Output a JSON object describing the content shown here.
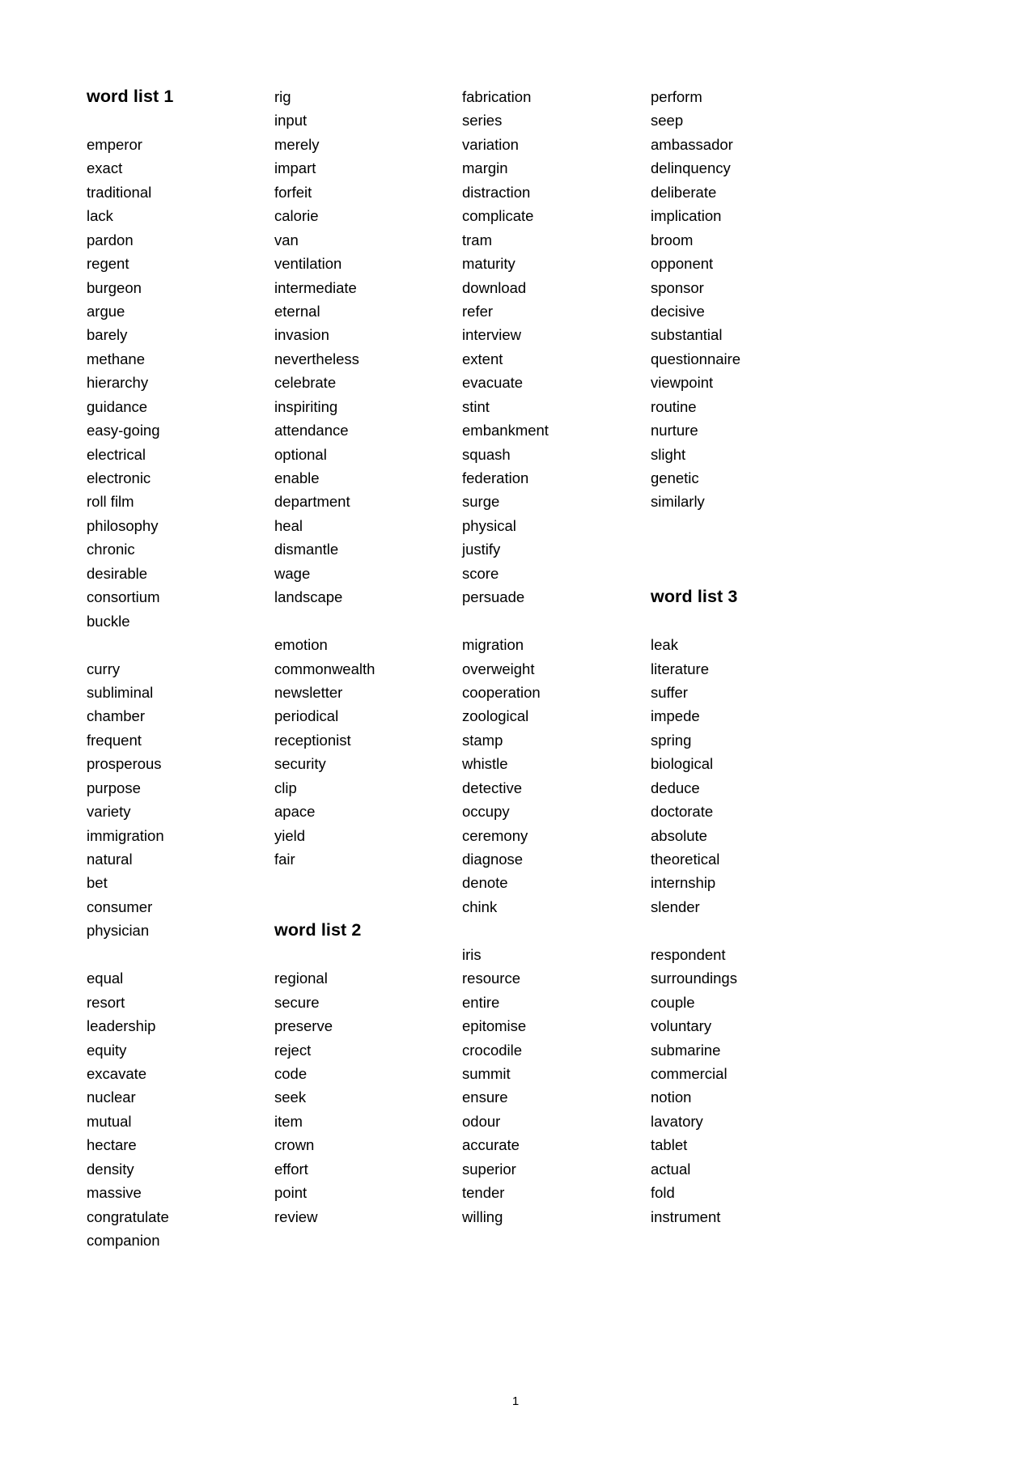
{
  "document": {
    "page_number": "1",
    "columns": [
      {
        "id": "column-1",
        "lines": [
          {
            "type": "heading",
            "text": "word list 1"
          },
          {
            "type": "blank"
          },
          {
            "type": "word",
            "text": "emperor"
          },
          {
            "type": "word",
            "text": "exact"
          },
          {
            "type": "word",
            "text": "traditional"
          },
          {
            "type": "word",
            "text": "lack"
          },
          {
            "type": "word",
            "text": "pardon"
          },
          {
            "type": "word",
            "text": "regent"
          },
          {
            "type": "word",
            "text": "burgeon"
          },
          {
            "type": "word",
            "text": "argue"
          },
          {
            "type": "word",
            "text": "barely"
          },
          {
            "type": "word",
            "text": "methane"
          },
          {
            "type": "word",
            "text": "hierarchy"
          },
          {
            "type": "word",
            "text": "guidance"
          },
          {
            "type": "word",
            "text": "easy-going"
          },
          {
            "type": "word",
            "text": "electrical"
          },
          {
            "type": "word",
            "text": "electronic"
          },
          {
            "type": "word",
            "text": "roll film"
          },
          {
            "type": "word",
            "text": "philosophy"
          },
          {
            "type": "word",
            "text": "chronic"
          },
          {
            "type": "word",
            "text": "desirable"
          },
          {
            "type": "word",
            "text": "consortium"
          },
          {
            "type": "word",
            "text": "buckle"
          },
          {
            "type": "blank"
          },
          {
            "type": "word",
            "text": "curry"
          },
          {
            "type": "word",
            "text": "subliminal"
          },
          {
            "type": "word",
            "text": "chamber"
          },
          {
            "type": "word",
            "text": "frequent"
          },
          {
            "type": "word",
            "text": "prosperous"
          },
          {
            "type": "word",
            "text": "purpose"
          },
          {
            "type": "word",
            "text": "variety"
          },
          {
            "type": "word",
            "text": "immigration"
          },
          {
            "type": "word",
            "text": "natural"
          },
          {
            "type": "word",
            "text": "bet"
          },
          {
            "type": "word",
            "text": "consumer"
          },
          {
            "type": "word",
            "text": "physician"
          },
          {
            "type": "blank"
          },
          {
            "type": "word",
            "text": "equal"
          },
          {
            "type": "word",
            "text": "resort"
          },
          {
            "type": "word",
            "text": "leadership"
          },
          {
            "type": "word",
            "text": "equity"
          },
          {
            "type": "word",
            "text": "excavate"
          },
          {
            "type": "word",
            "text": "nuclear"
          },
          {
            "type": "word",
            "text": "mutual"
          },
          {
            "type": "word",
            "text": "hectare"
          },
          {
            "type": "word",
            "text": "density"
          },
          {
            "type": "word",
            "text": "massive"
          },
          {
            "type": "word",
            "text": "congratulate"
          },
          {
            "type": "word",
            "text": "companion"
          }
        ]
      },
      {
        "id": "column-2",
        "lines": [
          {
            "type": "word",
            "text": "rig"
          },
          {
            "type": "word",
            "text": "input"
          },
          {
            "type": "word",
            "text": "merely"
          },
          {
            "type": "word",
            "text": "impart"
          },
          {
            "type": "word",
            "text": "forfeit"
          },
          {
            "type": "word",
            "text": "calorie"
          },
          {
            "type": "word",
            "text": "van"
          },
          {
            "type": "word",
            "text": "ventilation"
          },
          {
            "type": "word",
            "text": "intermediate"
          },
          {
            "type": "word",
            "text": "eternal"
          },
          {
            "type": "word",
            "text": "invasion"
          },
          {
            "type": "word",
            "text": "nevertheless"
          },
          {
            "type": "word",
            "text": "celebrate"
          },
          {
            "type": "word",
            "text": "inspiriting"
          },
          {
            "type": "word",
            "text": "attendance"
          },
          {
            "type": "word",
            "text": "optional"
          },
          {
            "type": "word",
            "text": "enable"
          },
          {
            "type": "word",
            "text": "department"
          },
          {
            "type": "word",
            "text": "heal"
          },
          {
            "type": "word",
            "text": "dismantle"
          },
          {
            "type": "word",
            "text": "wage"
          },
          {
            "type": "word",
            "text": "landscape"
          },
          {
            "type": "blank"
          },
          {
            "type": "word",
            "text": "emotion"
          },
          {
            "type": "word",
            "text": "commonwealth"
          },
          {
            "type": "word",
            "text": "newsletter"
          },
          {
            "type": "word",
            "text": "periodical"
          },
          {
            "type": "word",
            "text": "receptionist"
          },
          {
            "type": "word",
            "text": "security"
          },
          {
            "type": "word",
            "text": "clip"
          },
          {
            "type": "word",
            "text": "apace"
          },
          {
            "type": "word",
            "text": "yield"
          },
          {
            "type": "word",
            "text": "fair"
          },
          {
            "type": "blank"
          },
          {
            "type": "blank"
          },
          {
            "type": "heading",
            "text": "word list 2"
          },
          {
            "type": "blank"
          },
          {
            "type": "word",
            "text": "regional"
          },
          {
            "type": "word",
            "text": "secure"
          },
          {
            "type": "word",
            "text": "preserve"
          },
          {
            "type": "word",
            "text": "reject"
          },
          {
            "type": "word",
            "text": "code"
          },
          {
            "type": "word",
            "text": "seek"
          },
          {
            "type": "word",
            "text": "item"
          },
          {
            "type": "word",
            "text": "crown"
          },
          {
            "type": "word",
            "text": "effort"
          },
          {
            "type": "word",
            "text": "point"
          },
          {
            "type": "word",
            "text": "review"
          }
        ]
      },
      {
        "id": "column-3",
        "lines": [
          {
            "type": "word",
            "text": "fabrication"
          },
          {
            "type": "word",
            "text": "series"
          },
          {
            "type": "word",
            "text": "variation"
          },
          {
            "type": "word",
            "text": "margin"
          },
          {
            "type": "word",
            "text": "distraction"
          },
          {
            "type": "word",
            "text": "complicate"
          },
          {
            "type": "word",
            "text": "tram"
          },
          {
            "type": "word",
            "text": "maturity"
          },
          {
            "type": "word",
            "text": "download"
          },
          {
            "type": "word",
            "text": "refer"
          },
          {
            "type": "word",
            "text": "interview"
          },
          {
            "type": "word",
            "text": "extent"
          },
          {
            "type": "word",
            "text": "evacuate"
          },
          {
            "type": "word",
            "text": "stint"
          },
          {
            "type": "word",
            "text": "embankment"
          },
          {
            "type": "word",
            "text": "squash"
          },
          {
            "type": "word",
            "text": "federation"
          },
          {
            "type": "word",
            "text": "surge"
          },
          {
            "type": "word",
            "text": "physical"
          },
          {
            "type": "word",
            "text": "justify"
          },
          {
            "type": "word",
            "text": "score"
          },
          {
            "type": "word",
            "text": "persuade"
          },
          {
            "type": "blank"
          },
          {
            "type": "word",
            "text": "migration"
          },
          {
            "type": "word",
            "text": "overweight"
          },
          {
            "type": "word",
            "text": "cooperation"
          },
          {
            "type": "word",
            "text": "zoological"
          },
          {
            "type": "word",
            "text": "stamp"
          },
          {
            "type": "word",
            "text": "whistle"
          },
          {
            "type": "word",
            "text": "detective"
          },
          {
            "type": "word",
            "text": "occupy"
          },
          {
            "type": "word",
            "text": "ceremony"
          },
          {
            "type": "word",
            "text": "diagnose"
          },
          {
            "type": "word",
            "text": "denote"
          },
          {
            "type": "word",
            "text": "chink"
          },
          {
            "type": "blank"
          },
          {
            "type": "word",
            "text": "iris"
          },
          {
            "type": "word",
            "text": "resource"
          },
          {
            "type": "word",
            "text": "entire"
          },
          {
            "type": "word",
            "text": "epitomise"
          },
          {
            "type": "word",
            "text": "crocodile"
          },
          {
            "type": "word",
            "text": "summit"
          },
          {
            "type": "word",
            "text": "ensure"
          },
          {
            "type": "word",
            "text": "odour"
          },
          {
            "type": "word",
            "text": "accurate"
          },
          {
            "type": "word",
            "text": "superior"
          },
          {
            "type": "word",
            "text": "tender"
          },
          {
            "type": "word",
            "text": "willing"
          }
        ]
      },
      {
        "id": "column-4",
        "lines": [
          {
            "type": "word",
            "text": "perform"
          },
          {
            "type": "word",
            "text": "seep"
          },
          {
            "type": "word",
            "text": "ambassador"
          },
          {
            "type": "word",
            "text": "delinquency"
          },
          {
            "type": "word",
            "text": "deliberate"
          },
          {
            "type": "word",
            "text": "implication"
          },
          {
            "type": "word",
            "text": "broom"
          },
          {
            "type": "word",
            "text": "opponent"
          },
          {
            "type": "word",
            "text": "sponsor"
          },
          {
            "type": "word",
            "text": "decisive"
          },
          {
            "type": "word",
            "text": "substantial"
          },
          {
            "type": "word",
            "text": "questionnaire"
          },
          {
            "type": "word",
            "text": "viewpoint"
          },
          {
            "type": "word",
            "text": "routine"
          },
          {
            "type": "word",
            "text": "nurture"
          },
          {
            "type": "word",
            "text": "slight"
          },
          {
            "type": "word",
            "text": "genetic"
          },
          {
            "type": "word",
            "text": "similarly"
          },
          {
            "type": "blank"
          },
          {
            "type": "blank"
          },
          {
            "type": "blank"
          },
          {
            "type": "heading",
            "text": "word list 3"
          },
          {
            "type": "blank"
          },
          {
            "type": "word",
            "text": "leak"
          },
          {
            "type": "word",
            "text": "literature"
          },
          {
            "type": "word",
            "text": "suffer"
          },
          {
            "type": "word",
            "text": "impede"
          },
          {
            "type": "word",
            "text": "spring"
          },
          {
            "type": "word",
            "text": "biological"
          },
          {
            "type": "word",
            "text": "deduce"
          },
          {
            "type": "word",
            "text": "doctorate"
          },
          {
            "type": "word",
            "text": "absolute"
          },
          {
            "type": "word",
            "text": "theoretical"
          },
          {
            "type": "word",
            "text": "internship"
          },
          {
            "type": "word",
            "text": "slender"
          },
          {
            "type": "blank"
          },
          {
            "type": "word",
            "text": "respondent"
          },
          {
            "type": "word",
            "text": "surroundings"
          },
          {
            "type": "word",
            "text": "couple"
          },
          {
            "type": "word",
            "text": "voluntary"
          },
          {
            "type": "word",
            "text": "submarine"
          },
          {
            "type": "word",
            "text": "commercial"
          },
          {
            "type": "word",
            "text": "notion"
          },
          {
            "type": "word",
            "text": "lavatory"
          },
          {
            "type": "word",
            "text": "tablet"
          },
          {
            "type": "word",
            "text": "actual"
          },
          {
            "type": "word",
            "text": "fold"
          },
          {
            "type": "word",
            "text": "instrument"
          }
        ]
      }
    ]
  }
}
